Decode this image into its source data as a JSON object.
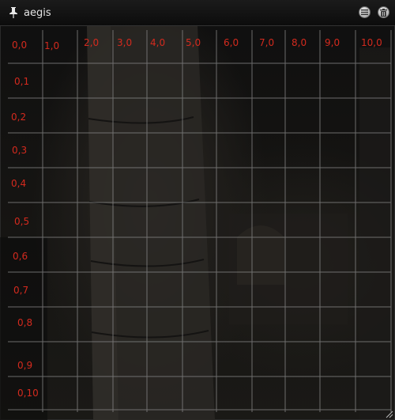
{
  "window": {
    "title": "aegis",
    "icons": {
      "pin": "pin-icon",
      "collapse": "collapse-icon",
      "delete": "trash-icon"
    }
  },
  "grid": {
    "label_color": "#d42a1e",
    "line_color": "#8a8a8a",
    "column_labels": [
      "0,0",
      "1,0",
      "2,0",
      "3,0",
      "4,0",
      "5,0",
      "6,0",
      "7,0",
      "8,0",
      "9,0",
      "10,0"
    ],
    "row_labels": [
      "0,1",
      "0,2",
      "0,3",
      "0,4",
      "0,5",
      "0,6",
      "0,7",
      "0,8",
      "0,9",
      "0,10"
    ]
  }
}
